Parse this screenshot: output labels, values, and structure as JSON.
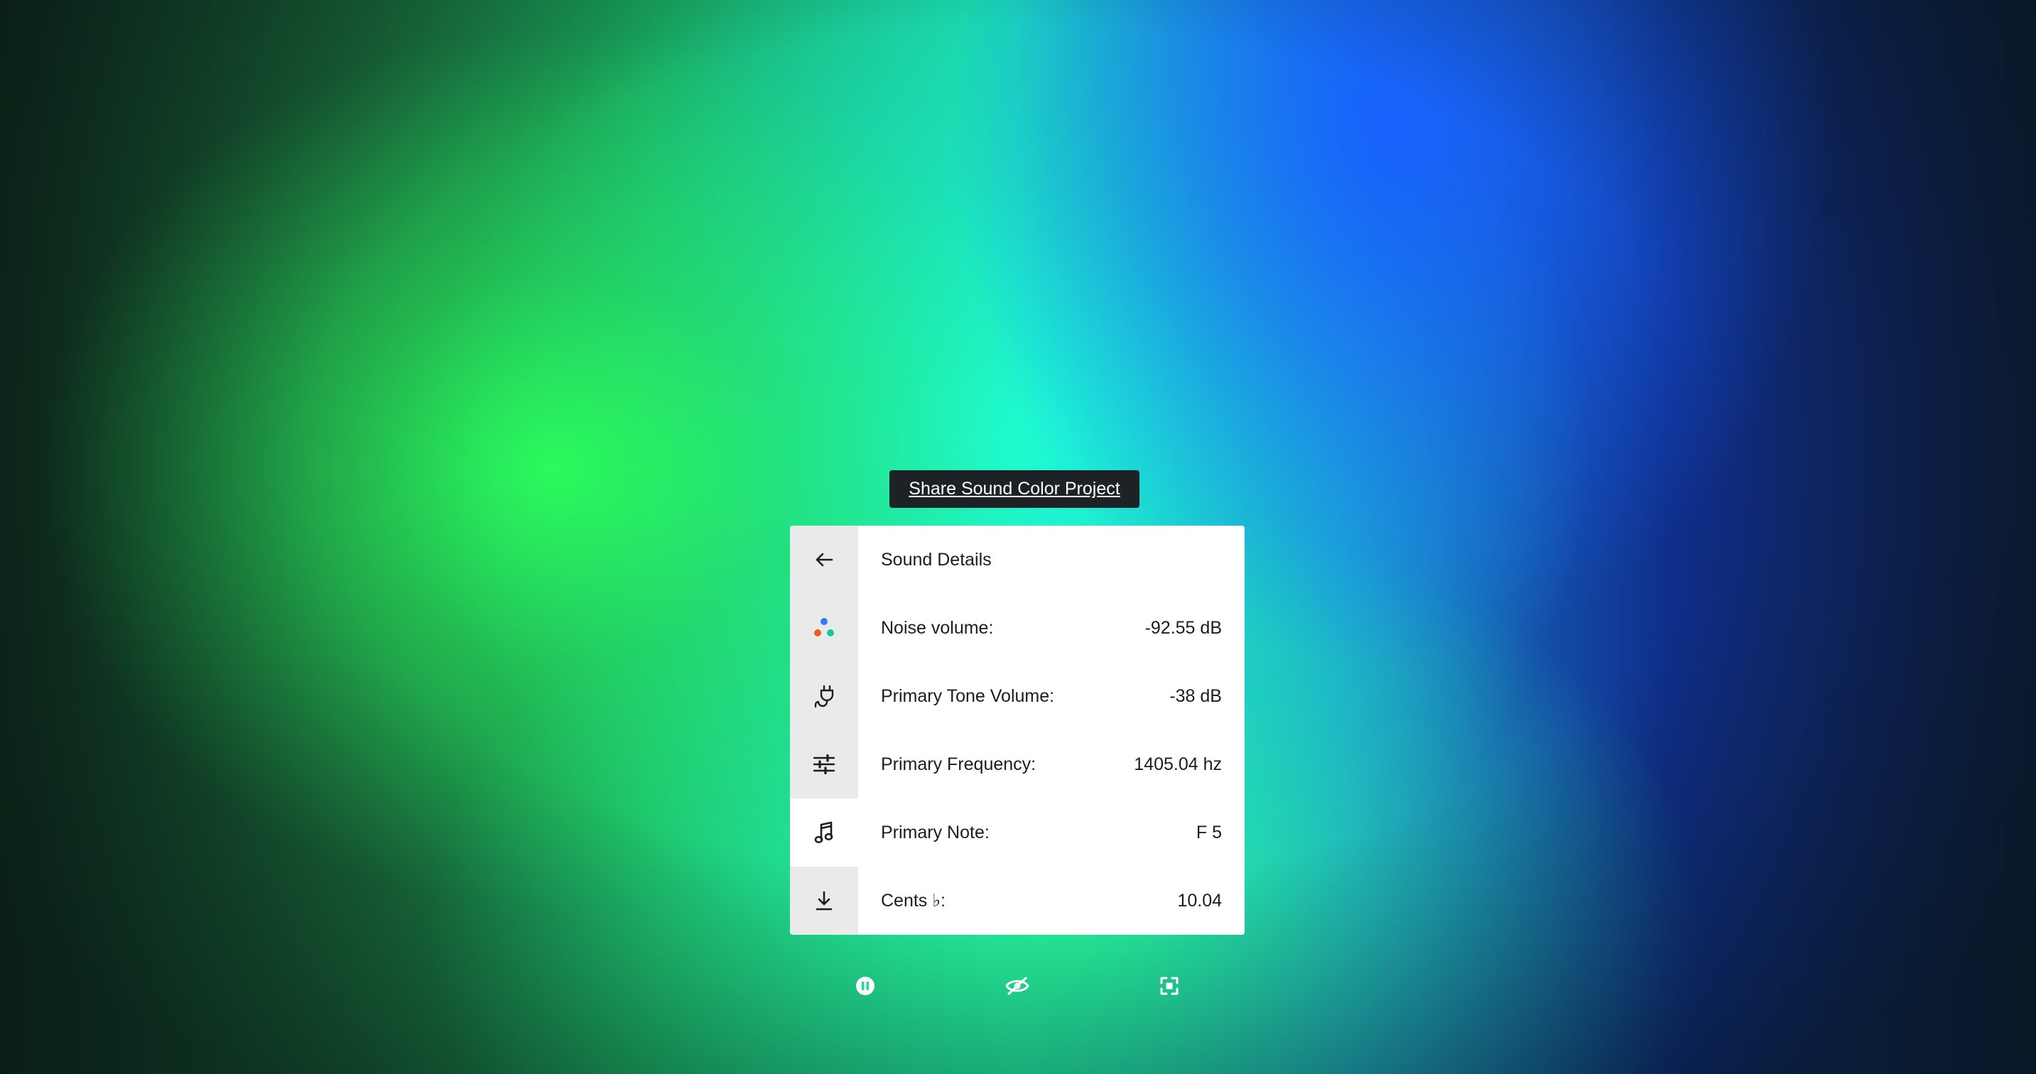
{
  "share": {
    "label": "Share Sound Color Project"
  },
  "panel": {
    "title": "Sound Details",
    "rows": [
      {
        "icon": "color-dots-icon",
        "label": "Noise volume:",
        "value": "-92.55 dB"
      },
      {
        "icon": "plug-icon",
        "label": "Primary Tone Volume:",
        "value": "-38 dB"
      },
      {
        "icon": "sliders-icon",
        "label": "Primary Frequency:",
        "value": "1405.04 hz"
      },
      {
        "icon": "music-note-icon",
        "label": "Primary Note:",
        "value": "F 5"
      },
      {
        "icon": "download-icon",
        "label": "Cents ♭:",
        "value": "10.04"
      }
    ]
  },
  "controls": {
    "items": [
      "pause-icon",
      "eye-off-icon",
      "fullscreen-icon"
    ]
  },
  "colors": {
    "panel_bg": "#ffffff",
    "icon_column_bg": "#e9eaea",
    "share_button_bg": "#1c2226",
    "dot_orange": "#f05a28",
    "dot_blue": "#2f7df6",
    "dot_teal": "#1ec6a0"
  }
}
